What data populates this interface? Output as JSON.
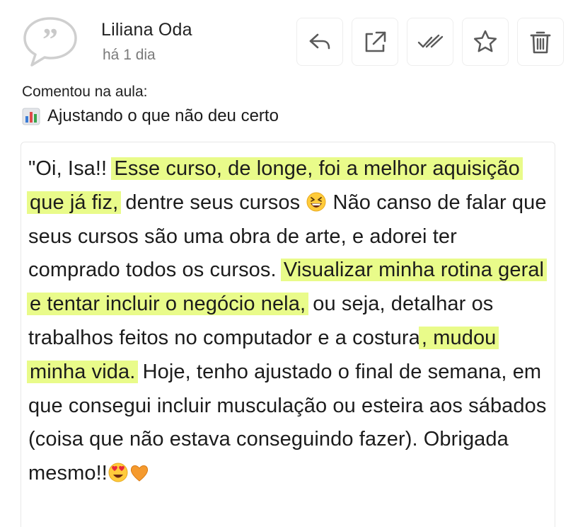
{
  "author": {
    "name": "Liliana Oda",
    "time": "há 1 dia",
    "avatar_icon": "quote-bubble-icon"
  },
  "actions": [
    {
      "icon": "reply-icon"
    },
    {
      "icon": "open-external-icon"
    },
    {
      "icon": "double-check-icon"
    },
    {
      "icon": "star-icon"
    },
    {
      "icon": "trash-icon"
    }
  ],
  "context": {
    "label": "Comentou na aula:",
    "lesson_icon": "bar-chart-icon",
    "lesson_title": "Ajustando o que não deu certo"
  },
  "comment": {
    "seg1": "\"Oi, Isa!! ",
    "hl1": "Esse curso, de longe, foi a melhor aquisição que já fiz,",
    "seg2": " dentre seus cursos ",
    "seg3": " Não canso de falar que seus cursos são uma obra de arte, e adorei ter comprado todos os cursos. ",
    "hl2": "Visualizar minha rotina geral e tentar incluir o negócio nela,",
    "seg4": " ou seja, detalhar os trabalhos feitos no computador e a costura",
    "hl3": ", mudou minha vida.",
    "seg5": " Hoje, tenho ajustado o final de semana, em que consegui incluir musculação ou esteira aos sábados (coisa que não estava conseguindo fazer). Obrigada mesmo!!",
    "emoji1": "grinning-squinting-face",
    "emoji2": "heart-eyes-face",
    "emoji3": "orange-heart"
  },
  "colors": {
    "highlight": "#e9fb8a",
    "icon": "#5a5a5a"
  }
}
